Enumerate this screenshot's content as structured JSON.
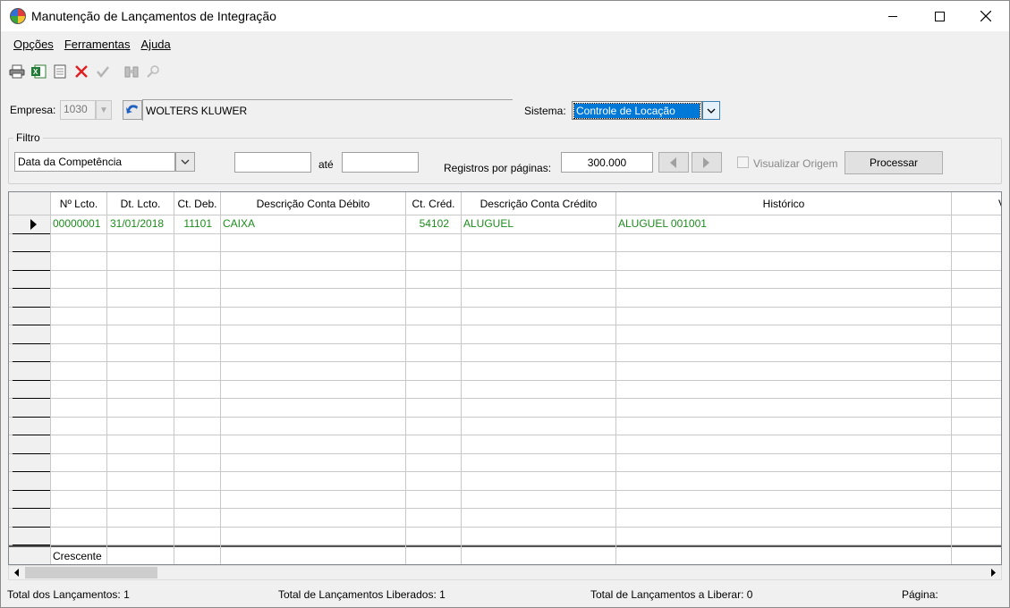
{
  "window": {
    "title": "Manutenção de Lançamentos de Integração",
    "minimize": "—",
    "maximize": "☐",
    "close": "✕"
  },
  "menu": [
    {
      "label": "Opções"
    },
    {
      "label": "Ferramentas"
    },
    {
      "label": "Ajuda"
    }
  ],
  "toolbar": {
    "icons": [
      "print-icon",
      "excel-icon",
      "document-icon",
      "delete-icon",
      "confirm-icon",
      "binoculars-icon",
      "search-icon"
    ]
  },
  "empresa": {
    "label": "Empresa:",
    "code": "1030",
    "name": "WOLTERS KLUWER"
  },
  "sistema": {
    "label": "Sistema:",
    "value": "Controle de Locação"
  },
  "filtro": {
    "title": "Filtro",
    "date_type": "Data da Competência",
    "date_from": "",
    "ate_label": "até",
    "date_to": "",
    "registros_label": "Registros por páginas:",
    "registros_value": "300.000",
    "visualizar_label": "Visualizar Origem",
    "visualizar_checked": false,
    "processar_label": "Processar"
  },
  "grid": {
    "columns": [
      "Nº Lcto.",
      "Dt. Lcto.",
      "Ct. Deb.",
      "Descrição Conta Débito",
      "Ct. Créd.",
      "Descrição Conta Crédito",
      "Histórico",
      "V"
    ],
    "rows": [
      {
        "n_lcto": "00000001",
        "dt_lcto": "31/01/2018",
        "ct_deb": "11101",
        "desc_deb": "CAIXA",
        "ct_cred": "54102",
        "desc_cred": "ALUGUEL",
        "historico": "ALUGUEL 001001"
      }
    ],
    "footer_label": "Crescente",
    "row_color": "#1c8c1c"
  },
  "status": {
    "total": "Total dos Lançamentos: 1",
    "liberados": "Total de Lançamentos Liberados: 1",
    "a_liberar": "Total de Lançamentos a Liberar: 0",
    "pagina": "Página:"
  }
}
